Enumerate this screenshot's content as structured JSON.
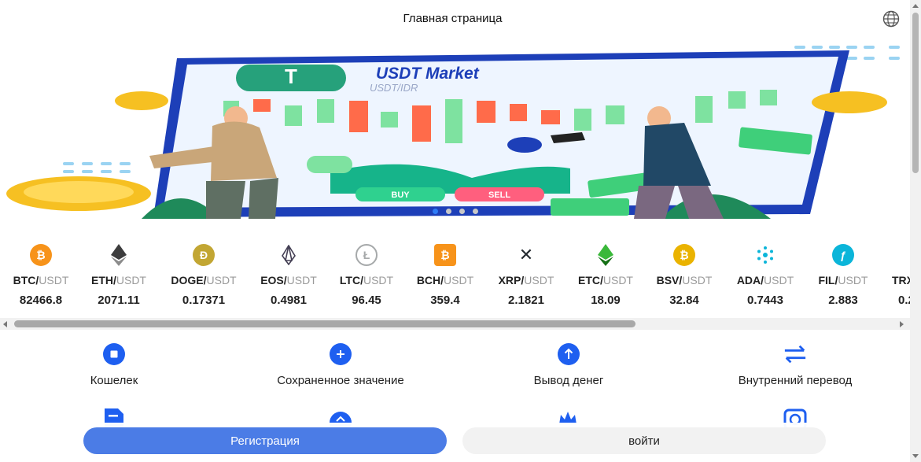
{
  "header": {
    "title": "Главная страница",
    "language_icon": "globe-icon"
  },
  "banner": {
    "heading": "USDT Market",
    "subheading": "USDT/IDR",
    "buy_label": "BUY",
    "sell_label": "SELL",
    "slides_total": 4,
    "active_slide": 1
  },
  "ticker": [
    {
      "base": "BTC/",
      "quote": "USDT",
      "price": "82466.8",
      "icon": "bitcoin-icon",
      "color": "#f7931a"
    },
    {
      "base": "ETH/",
      "quote": "USDT",
      "price": "2071.11",
      "icon": "ethereum-icon",
      "color": "#3c3c3d"
    },
    {
      "base": "DOGE/",
      "quote": "USDT",
      "price": "0.17371",
      "icon": "dogecoin-icon",
      "color": "#c2a633"
    },
    {
      "base": "EOS/",
      "quote": "USDT",
      "price": "0.4981",
      "icon": "eos-icon",
      "color": "#443f54"
    },
    {
      "base": "LTC/",
      "quote": "USDT",
      "price": "96.45",
      "icon": "litecoin-icon",
      "color": "#a6a9aa"
    },
    {
      "base": "BCH/",
      "quote": "USDT",
      "price": "359.4",
      "icon": "bitcoin-cash-icon",
      "color": "#f7931a"
    },
    {
      "base": "XRP/",
      "quote": "USDT",
      "price": "2.1821",
      "icon": "xrp-icon",
      "color": "#23292f"
    },
    {
      "base": "ETC/",
      "quote": "USDT",
      "price": "18.09",
      "icon": "ethereum-classic-icon",
      "color": "#3ab83a"
    },
    {
      "base": "BSV/",
      "quote": "USDT",
      "price": "32.84",
      "icon": "bitcoin-sv-icon",
      "color": "#eab300"
    },
    {
      "base": "ADA/",
      "quote": "USDT",
      "price": "0.7443",
      "icon": "cardano-icon",
      "color": "#0bb5d9"
    },
    {
      "base": "FIL/",
      "quote": "USDT",
      "price": "2.883",
      "icon": "filecoin-icon",
      "color": "#0090ff"
    },
    {
      "base": "TRX",
      "quote": "",
      "price": "0.2",
      "icon": "tron-icon",
      "color": "#ef0027"
    }
  ],
  "menu": [
    {
      "label": "Кошелек",
      "icon": "wallet-icon"
    },
    {
      "label": "Сохраненное значение",
      "icon": "deposit-plus-icon"
    },
    {
      "label": "Вывод денег",
      "icon": "withdraw-arrow-icon"
    },
    {
      "label": "Внутренний перевод",
      "icon": "transfer-arrows-icon"
    }
  ],
  "actions": {
    "register_label": "Регистрация",
    "login_label": "войти"
  },
  "colors": {
    "accent": "#1e5ff0",
    "register_button": "#4b7ce6",
    "login_button": "#f2f2f2"
  }
}
